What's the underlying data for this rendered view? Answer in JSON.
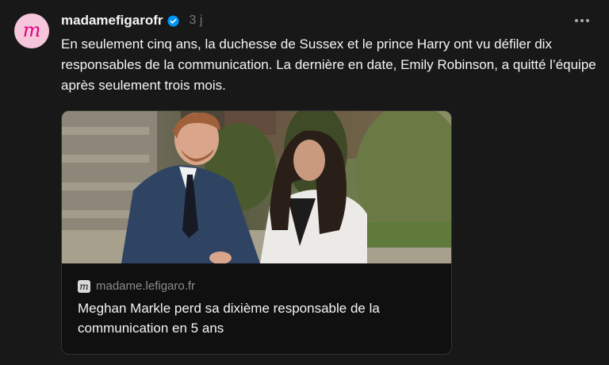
{
  "post": {
    "avatar_letter": "m",
    "username": "madamefigarofr",
    "verified_icon": "verified-badge-icon",
    "timestamp": "3 j",
    "more_icon": "more-options-icon",
    "text": "En seulement cinq ans, la duchesse de Sussex et le prince Harry ont vu défiler dix responsables de la communication. La dernière en date, Emily Robinson, a quitté l’équipe après seulement trois mois."
  },
  "link_card": {
    "domain": "madame.lefigaro.fr",
    "site_icon_letter": "m",
    "title": "Meghan Markle perd sa dixième responsable de la communication en 5 ans"
  },
  "colors": {
    "background": "#181818",
    "avatar_bg": "#f6c6dd",
    "avatar_letter": "#e6007e",
    "verified": "#0095f6",
    "muted_text": "#777777"
  }
}
